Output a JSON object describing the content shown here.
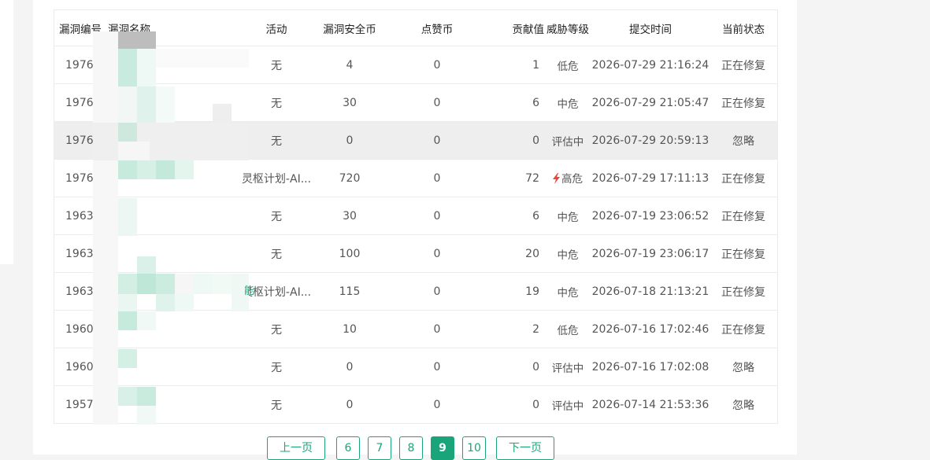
{
  "table": {
    "headers": {
      "id": "漏洞编号",
      "name": "漏洞名称",
      "activity": "活动",
      "coins": "漏洞安全币",
      "likes": "点赞币",
      "contrib": "贡献值",
      "level": "威胁等级",
      "time": "提交时间",
      "status": "当前状态"
    },
    "rows": [
      {
        "id": "1976",
        "name": "",
        "activity": "无",
        "coins": "4",
        "likes": "0",
        "contrib": "1",
        "level": "低危",
        "time": "2026-07-29 21:16:24",
        "status": "正在修复"
      },
      {
        "id": "1976",
        "name": "",
        "activity": "无",
        "coins": "30",
        "likes": "0",
        "contrib": "6",
        "level": "中危",
        "time": "2026-07-29 21:05:47",
        "status": "正在修复"
      },
      {
        "id": "1976",
        "name": "",
        "activity": "无",
        "coins": "0",
        "likes": "0",
        "contrib": "0",
        "level": "评估中",
        "time": "2026-07-29 20:59:13",
        "status": "忽略"
      },
      {
        "id": "1976",
        "name": "",
        "activity": "灵枢计划-AI...",
        "coins": "720",
        "likes": "0",
        "contrib": "72",
        "level": "高危",
        "time": "2026-07-29 17:11:13",
        "status": "正在修复"
      },
      {
        "id": "1963",
        "name": "",
        "activity": "无",
        "coins": "30",
        "likes": "0",
        "contrib": "6",
        "level": "中危",
        "time": "2026-07-19 23:06:52",
        "status": "正在修复"
      },
      {
        "id": "1963",
        "name": "",
        "activity": "无",
        "coins": "100",
        "likes": "0",
        "contrib": "20",
        "level": "中危",
        "time": "2026-07-19 23:06:17",
        "status": "正在修复"
      },
      {
        "id": "1963",
        "name": "",
        "activity": "灵枢计划-AI...",
        "coins": "115",
        "likes": "0",
        "contrib": "19",
        "level": "中危",
        "time": "2026-07-18 21:13:21",
        "status": "正在修复"
      },
      {
        "id": "1960",
        "name": "",
        "activity": "无",
        "coins": "10",
        "likes": "0",
        "contrib": "2",
        "level": "低危",
        "time": "2026-07-16 17:02:46",
        "status": "正在修复"
      },
      {
        "id": "1960",
        "name": "",
        "activity": "无",
        "coins": "0",
        "likes": "0",
        "contrib": "0",
        "level": "评估中",
        "time": "2026-07-16 17:02:08",
        "status": "忽略"
      },
      {
        "id": "1957",
        "name": "",
        "activity": "无",
        "coins": "0",
        "likes": "0",
        "contrib": "0",
        "level": "评估中",
        "time": "2026-07-14 21:53:36",
        "status": "忽略"
      }
    ],
    "highlight_row": 2,
    "high_risk_icon": "lightning-bolt-icon",
    "high_risk_color": "#e8453c"
  },
  "name_fragment": "能",
  "pagination": {
    "prev": "上一页",
    "pages": [
      "6",
      "7",
      "8",
      "9",
      "10"
    ],
    "current": "9",
    "next": "下一页"
  },
  "colors": {
    "accent": "#19a579",
    "row_highlight": "#eeeeee"
  }
}
